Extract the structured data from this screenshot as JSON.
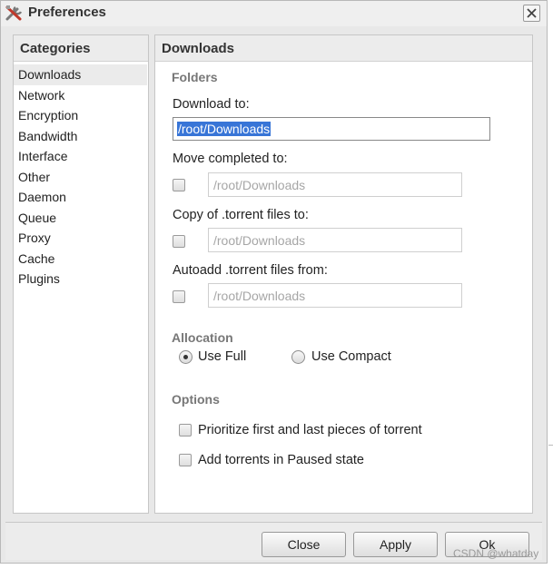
{
  "window": {
    "title": "Preferences"
  },
  "categories": {
    "header": "Categories",
    "items": [
      "Downloads",
      "Network",
      "Encryption",
      "Bandwidth",
      "Interface",
      "Other",
      "Daemon",
      "Queue",
      "Proxy",
      "Cache",
      "Plugins"
    ],
    "selected": "Downloads"
  },
  "main": {
    "header": "Downloads",
    "folders": {
      "title": "Folders",
      "download_to_label": "Download to:",
      "download_to_value": "/root/Downloads",
      "move_completed_label": "Move completed to:",
      "move_completed_value": "/root/Downloads",
      "copy_torrent_label": "Copy of .torrent files to:",
      "copy_torrent_value": "/root/Downloads",
      "autoadd_label": "Autoadd .torrent files from:",
      "autoadd_value": "/root/Downloads"
    },
    "allocation": {
      "title": "Allocation",
      "use_full": "Use Full",
      "use_compact": "Use Compact",
      "selected": "Use Full"
    },
    "options": {
      "title": "Options",
      "prioritize": "Prioritize first and last pieces of torrent",
      "paused": "Add torrents in Paused state"
    }
  },
  "buttons": {
    "close": "Close",
    "apply": "Apply",
    "ok": "Ok"
  },
  "watermark": "CSDN @whatday"
}
